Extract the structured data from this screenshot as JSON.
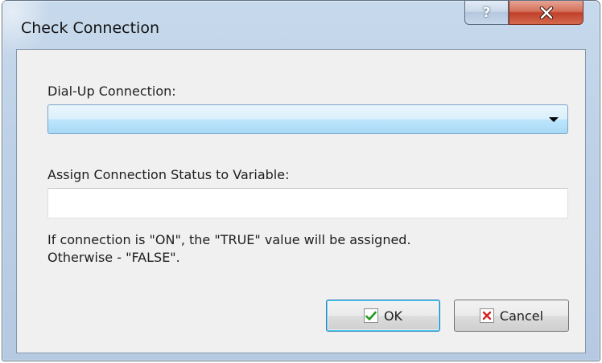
{
  "window": {
    "title": "Check Connection",
    "help_label": "?"
  },
  "form": {
    "connection_label": "Dial-Up Connection:",
    "connection_value": "",
    "variable_label": "Assign Connection Status to Variable:",
    "variable_value": "",
    "info_line1": "If connection is \"ON\", the \"TRUE\" value will be assigned.",
    "info_line2": "Otherwise - \"FALSE\"."
  },
  "buttons": {
    "ok_label": "OK",
    "cancel_label": "Cancel"
  },
  "icons": {
    "help": "question-mark",
    "close": "x-mark",
    "ok": "green-checkmark",
    "cancel": "red-x"
  },
  "colors": {
    "close_button": "#c7442e",
    "ok_check": "#1f9a1f",
    "cancel_x": "#d42020",
    "combo_fill": "#bee6fd",
    "default_button_border": "#3c7fb1"
  }
}
